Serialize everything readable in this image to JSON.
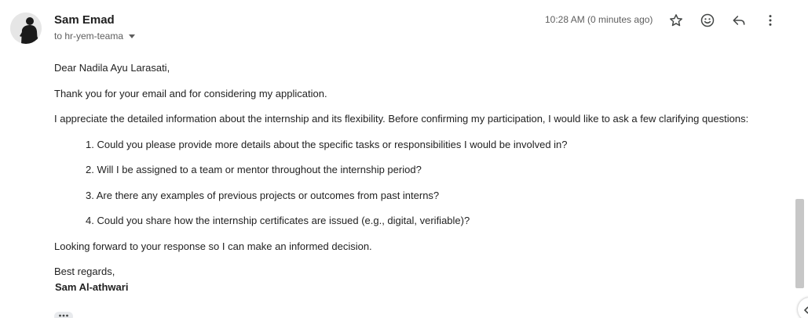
{
  "header": {
    "sender_name": "Sam Emad",
    "recipient": "to hr-yem-teama",
    "timestamp": "10:28 AM (0 minutes ago)"
  },
  "actions": {
    "star": "star-icon",
    "emoji": "emoji-icon",
    "reply": "reply-icon",
    "more": "more-vert-icon"
  },
  "message": {
    "greeting": "Dear Nadila Ayu Larasati,",
    "thanks": "Thank you for your email and for considering my application.",
    "intro": "I appreciate the detailed information about the internship and its flexibility. Before confirming my participation, I would like to ask a few clarifying questions:",
    "questions": [
      "1. Could you please provide more details about the specific tasks or responsibilities I would be involved in?",
      "2. Will I be assigned to a team or mentor throughout the internship period?",
      "3. Are there any examples of previous projects or outcomes from past interns?",
      "4. Could you share how the internship certificates are issued (e.g., digital, verifiable)?"
    ],
    "closing": "Looking forward to your response so I can make an informed decision.",
    "regards": "Best regards,",
    "signature": "Sam Al-athwari"
  },
  "colors": {
    "text": "#222222",
    "muted": "#5e5e5e",
    "icon": "#444746"
  }
}
